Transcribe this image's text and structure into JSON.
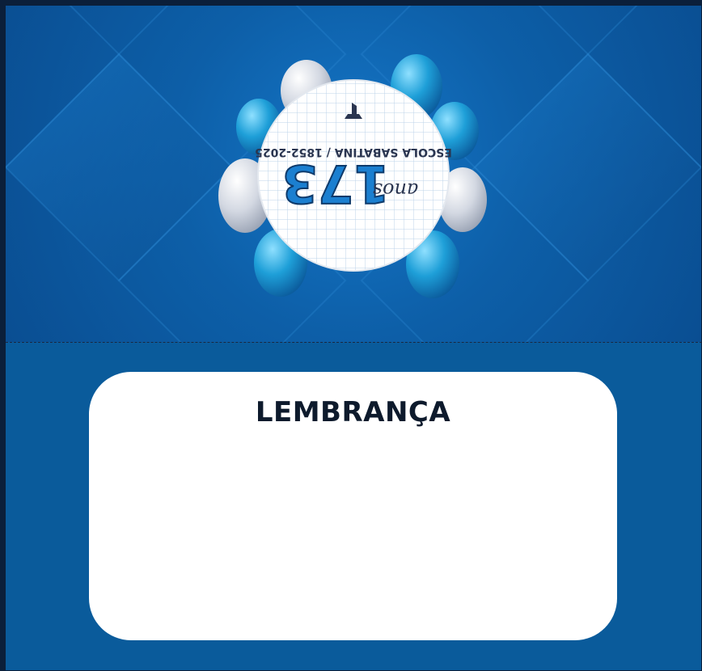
{
  "card": {
    "title": "LEMBRANÇA"
  },
  "emblem": {
    "school_line": "ESCOLA SABATINA / 1852-2025",
    "number": "173",
    "script_word": "anos",
    "orientation": "upside-down",
    "logo_icon": "school-logo-icon"
  },
  "colors": {
    "panel_blue": "#0a5b9b",
    "accent_blue": "#1b7fd0",
    "balloon_silver": "#d9dde6",
    "balloon_blue": "#1e9fd8",
    "title_text": "#0d1a2c"
  }
}
